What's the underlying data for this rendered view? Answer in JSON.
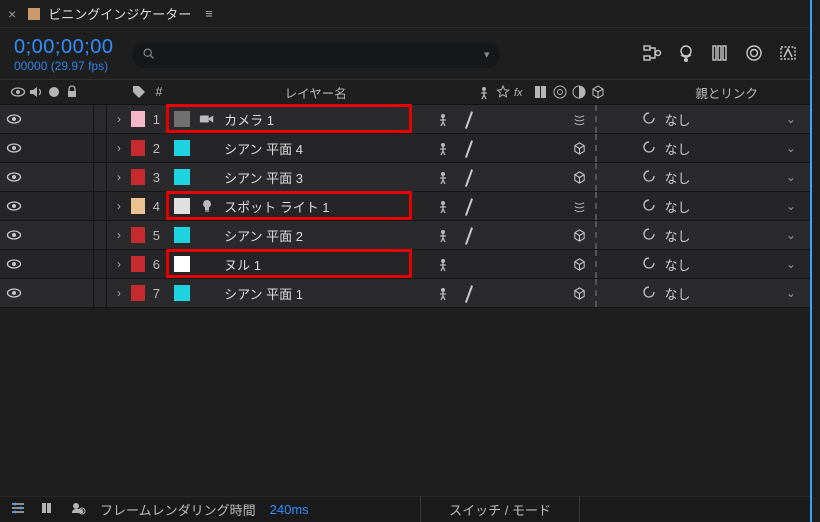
{
  "tab": {
    "title": "ビニングインジケーター"
  },
  "timecode": {
    "main": "0;00;00;00",
    "sub": "00000 (29.97 fps)"
  },
  "columns": {
    "name_header": "レイヤー名",
    "parent_header": "親とリンク"
  },
  "layers": [
    {
      "index": 1,
      "name": "カメラ 1",
      "labelColor": "#f4b6c8",
      "swatch": "#707070",
      "icon": "camera",
      "collapse": true,
      "threed": "env",
      "highlight": true
    },
    {
      "index": 2,
      "name": "シアン 平面 4",
      "labelColor": "#c52a2f",
      "swatch": "#1fd2e0",
      "icon": "none",
      "collapse": true,
      "threed": "cube",
      "highlight": false
    },
    {
      "index": 3,
      "name": "シアン 平面 3",
      "labelColor": "#c52a2f",
      "swatch": "#1fd2e0",
      "icon": "none",
      "collapse": true,
      "threed": "cube",
      "highlight": false
    },
    {
      "index": 4,
      "name": "スポット ライト 1",
      "labelColor": "#ecc290",
      "swatch": "#e0e0e0",
      "icon": "light",
      "collapse": true,
      "threed": "env",
      "highlight": true
    },
    {
      "index": 5,
      "name": "シアン 平面 2",
      "labelColor": "#c52a2f",
      "swatch": "#1fd2e0",
      "icon": "none",
      "collapse": true,
      "threed": "cube",
      "highlight": false
    },
    {
      "index": 6,
      "name": "ヌル 1",
      "labelColor": "#c52a2f",
      "swatch": "#ffffff",
      "icon": "none",
      "collapse": false,
      "threed": "cube",
      "highlight": true
    },
    {
      "index": 7,
      "name": "シアン 平面 1",
      "labelColor": "#c52a2f",
      "swatch": "#1fd2e0",
      "icon": "none",
      "collapse": true,
      "threed": "cube",
      "highlight": false
    }
  ],
  "parent_default": "なし",
  "footer": {
    "render_label": "フレームレンダリング時間",
    "render_time": "240ms",
    "mode_toggle": "スイッチ / モード"
  }
}
